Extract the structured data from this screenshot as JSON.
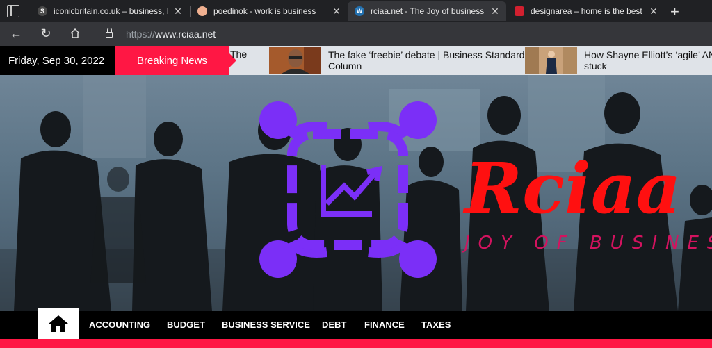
{
  "browser": {
    "tabs": [
      {
        "title": "iconicbritain.co.uk – business, En",
        "favicon_color": "#4a4a4a"
      },
      {
        "title": "poedinok - work is business",
        "favicon_color": "#f0b090"
      },
      {
        "title": "rciaa.net - The Joy of business",
        "favicon_color": "#2271b1"
      },
      {
        "title": "designarea – home is the best",
        "favicon_color": "#d2202f"
      }
    ],
    "new_tab_symbol": "+",
    "close_symbol": "✕",
    "url_prefix": "https://",
    "url_domain": "www.rciaa.net"
  },
  "ticker": {
    "date": "Friday, Sep 30, 2022",
    "breaking_label": "Breaking News",
    "partial_text": "The",
    "items": [
      {
        "title": "The fake ‘freebie’ debate | Business Standard Column"
      },
      {
        "title": "How Shayne Elliott’s ‘agile’ AN stuck"
      }
    ]
  },
  "hero": {
    "brand": "Rciaa",
    "tagline": "JOY OF BUSINESS"
  },
  "menu": {
    "items": [
      "ACCOUNTING",
      "BUDGET",
      "BUSINESS SERVICE",
      "DEBT",
      "FINANCE",
      "TAXES"
    ]
  },
  "colors": {
    "accent": "#ff1744",
    "logo_purple": "#7b2ff7",
    "brand_red": "#ff1010"
  }
}
